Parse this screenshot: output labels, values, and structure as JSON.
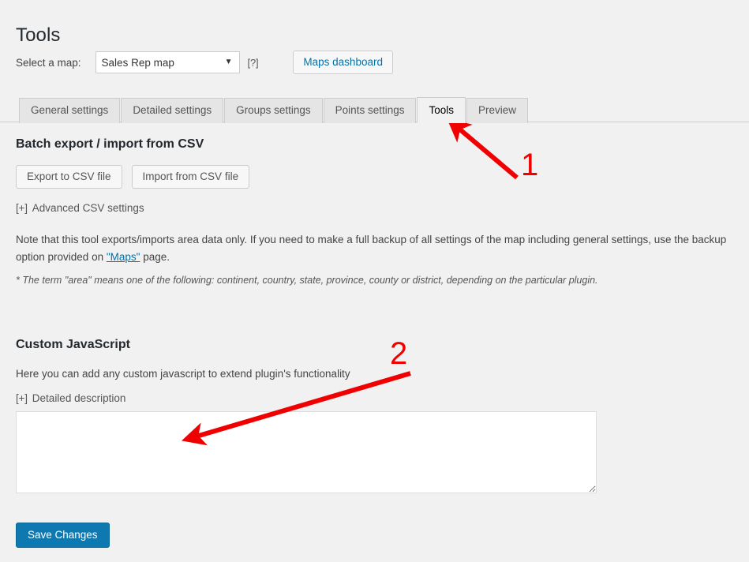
{
  "page": {
    "title": "Tools",
    "background": "#f1f1f1"
  },
  "map_selector": {
    "label": "Select a map:",
    "selected_map": "Sales Rep map",
    "caret_icon": "chevron-down-icon",
    "help_label": "[?]",
    "dashboard_button": "Maps dashboard",
    "link_color": "#0073aa"
  },
  "tabs": [
    {
      "label": "General settings",
      "active": false
    },
    {
      "label": "Detailed settings",
      "active": false
    },
    {
      "label": "Groups settings",
      "active": false
    },
    {
      "label": "Points settings",
      "active": false
    },
    {
      "label": "Tools",
      "active": true
    },
    {
      "label": "Preview",
      "active": false
    }
  ],
  "batch_section": {
    "heading": "Batch export / import from CSV",
    "export_button": "Export to CSV file",
    "import_button": "Import from CSV file",
    "advanced_toggle_marker": "[+]",
    "advanced_toggle_label": "Advanced CSV settings",
    "note_part1": "Note that this tool exports/imports area data only. If you need to make a full backup of all settings of the map including general settings, use the backup option provided on ",
    "note_link": "\"Maps\"",
    "note_part2": " page.",
    "footnote": "* The term \"area\" means one of the following: continent, country, state, province, county or district, depending on the particular plugin."
  },
  "javascript_section": {
    "heading": "Custom JavaScript",
    "description": "Here you can add any custom javascript to extend plugin's functionality",
    "detailed_toggle_marker": "[+]",
    "detailed_toggle_label": "Detailed description",
    "textarea_value": "",
    "textarea_placeholder": ""
  },
  "footer": {
    "save_button": "Save Changes",
    "save_button_color": "#0e78b0"
  },
  "annotations": {
    "color": "#f00000",
    "marker_1": "1",
    "marker_2": "2"
  }
}
